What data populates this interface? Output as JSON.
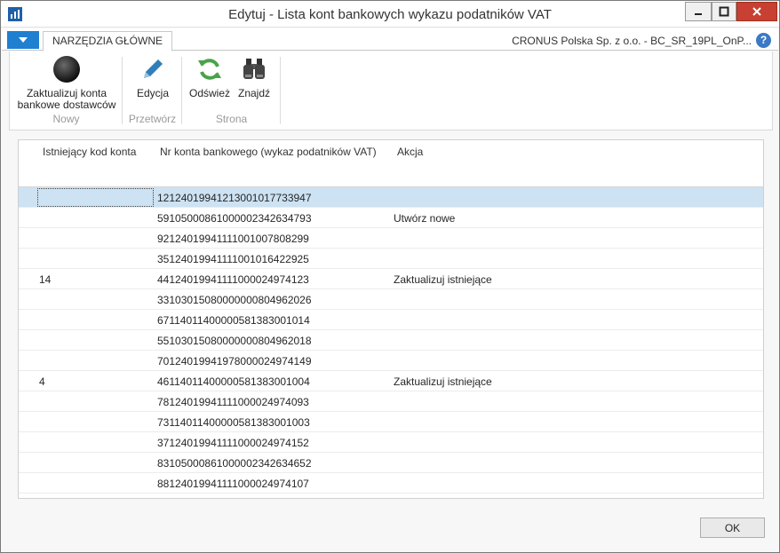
{
  "window": {
    "title": "Edytuj - Lista kont bankowych wykazu podatników VAT",
    "controls": {
      "minimize": "minimize-icon",
      "maximize": "maximize-icon",
      "close": "close-icon"
    }
  },
  "ribbon": {
    "tab": "NARZĘDZIA GŁÓWNE",
    "company": "CRONUS Polska Sp. z o.o. - BC_SR_19PL_OnP...",
    "help": "?",
    "groups": [
      {
        "label": "Nowy",
        "buttons": [
          {
            "label": "Zaktualizuj konta bankowe dostawców",
            "icon": "sphere-icon"
          }
        ]
      },
      {
        "label": "Przetwórz",
        "buttons": [
          {
            "label": "Edycja",
            "icon": "pencil-icon"
          }
        ]
      },
      {
        "label": "Strona",
        "buttons": [
          {
            "label": "Odśwież",
            "icon": "refresh-icon"
          },
          {
            "label": "Znajdź",
            "icon": "binoculars-icon"
          }
        ]
      }
    ]
  },
  "table": {
    "columns": [
      "Istniejący kod konta",
      "Nr konta bankowego (wykaz podatników VAT)",
      "Akcja"
    ],
    "rows": [
      {
        "code": "",
        "account": "12124019941213001017733947",
        "action": ""
      },
      {
        "code": "",
        "account": "59105000861000002342634793",
        "action": "Utwórz nowe"
      },
      {
        "code": "",
        "account": "92124019941111001007808299",
        "action": ""
      },
      {
        "code": "",
        "account": "35124019941111001016422925",
        "action": ""
      },
      {
        "code": "14",
        "account": "44124019941111000024974123",
        "action": "Zaktualizuj istniejące"
      },
      {
        "code": "",
        "account": "33103015080000000804962026",
        "action": ""
      },
      {
        "code": "",
        "account": "67114011400000581383001014",
        "action": ""
      },
      {
        "code": "",
        "account": "55103015080000000804962018",
        "action": ""
      },
      {
        "code": "",
        "account": "70124019941978000024974149",
        "action": ""
      },
      {
        "code": "4",
        "account": "46114011400000581383001004",
        "action": "Zaktualizuj istniejące"
      },
      {
        "code": "",
        "account": "78124019941111000024974093",
        "action": ""
      },
      {
        "code": "",
        "account": "73114011400000581383001003",
        "action": ""
      },
      {
        "code": "",
        "account": "37124019941111000024974152",
        "action": ""
      },
      {
        "code": "",
        "account": "83105000861000002342634652",
        "action": ""
      },
      {
        "code": "",
        "account": "88124019941111000024974107",
        "action": ""
      }
    ]
  },
  "footer": {
    "ok_label": "OK"
  },
  "colors": {
    "accent": "#1f7fd0",
    "selection": "#cde2f2",
    "close": "#c84031",
    "refresh": "#4aa24a",
    "pencil": "#2f7fb8"
  }
}
